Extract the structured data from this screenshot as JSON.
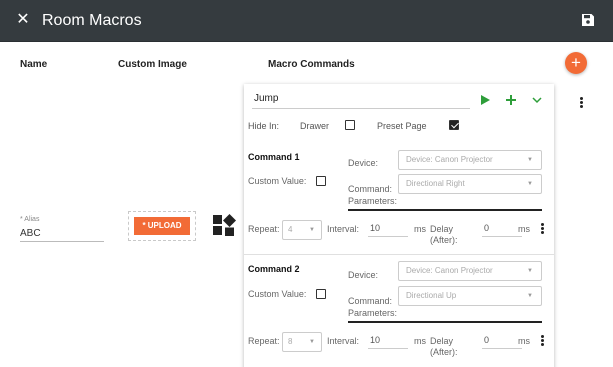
{
  "header": {
    "title": "Room Macros",
    "close_icon": "close-icon",
    "save_icon": "floppy-save-icon",
    "bg_color": "#353b3f"
  },
  "columns": {
    "name": "Name",
    "custom_image": "Custom Image",
    "macro_commands": "Macro Commands"
  },
  "add_button": {
    "label": "+",
    "color": "#f26b36"
  },
  "alias": {
    "label": "* Alias",
    "value": "ABC"
  },
  "upload": {
    "label": "* UPLOAD"
  },
  "macro": {
    "name": "Jump",
    "hide_in_label": "Hide In:",
    "drawer_label": "Drawer",
    "drawer_checked": false,
    "preset_page_label": "Preset Page",
    "preset_page_checked": true,
    "commands": [
      {
        "title": "Command 1",
        "device_label": "Device:",
        "device_value": "Device: Canon Projector",
        "custom_value_label": "Custom Value:",
        "custom_value_checked": false,
        "command_label": "Command:",
        "command_value": "Directional Right",
        "parameters_label": "Parameters:",
        "repeat_label": "Repeat:",
        "repeat_value": "4",
        "interval_label": "Interval:",
        "interval_value": "10",
        "interval_unit": "ms",
        "delay_label": "Delay",
        "delay_label_2": "(After):",
        "delay_value": "0",
        "delay_unit": "ms"
      },
      {
        "title": "Command 2",
        "device_label": "Device:",
        "device_value": "Device: Canon Projector",
        "custom_value_label": "Custom Value:",
        "custom_value_checked": false,
        "command_label": "Command:",
        "command_value": "Directional Up",
        "parameters_label": "Parameters:",
        "repeat_label": "Repeat:",
        "repeat_value": "8",
        "interval_label": "Interval:",
        "interval_value": "10",
        "interval_unit": "ms",
        "delay_label": "Delay",
        "delay_label_2": "(After):",
        "delay_value": "0",
        "delay_unit": "ms"
      }
    ]
  },
  "icons": {
    "play": "play-icon",
    "add": "plus-icon",
    "expand": "chevron-down-icon",
    "more": "more-vertical-icon",
    "image": "shapes-image-icon"
  },
  "colors": {
    "accent": "#f26b36",
    "action_green": "#2e9e3a"
  }
}
